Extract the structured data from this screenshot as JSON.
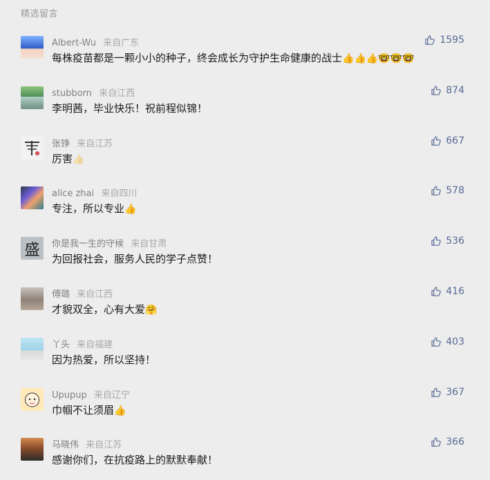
{
  "section_title": "精选留言",
  "comments": [
    {
      "nickname": "Albert-Wu",
      "location": "来自广东",
      "text": "每株疫苗都是一颗小小的种子，终会成长为守护生命健康的战士",
      "emoji": "👍👍👍🤓🤓🤓",
      "likes": "1595"
    },
    {
      "nickname": "stubborn",
      "location": "来自江西",
      "text": "李明茜，毕业快乐！祝前程似锦！",
      "emoji": "",
      "likes": "874"
    },
    {
      "nickname": "张铮",
      "location": "来自江苏",
      "text": "厉害",
      "emoji": "👍",
      "likes": "667"
    },
    {
      "nickname": "alice zhai",
      "location": "来自四川",
      "text": "专注，所以专业",
      "emoji": "👍",
      "likes": "578"
    },
    {
      "nickname": "你是我一生的守候",
      "location": "来自甘肃",
      "text": "为回报社会，服务人民的学子点赞！",
      "emoji": "",
      "likes": "536"
    },
    {
      "nickname": "傅璐",
      "location": "来自江西",
      "text": "才貌双全，心有大爱",
      "emoji": "🤗",
      "likes": "416"
    },
    {
      "nickname": "丫头",
      "location": "来自福建",
      "text": "因为热爱，所以坚持！",
      "emoji": "",
      "likes": "403"
    },
    {
      "nickname": "Upupup",
      "location": "来自辽宁",
      "text": "巾帼不让须眉",
      "emoji": "👍",
      "likes": "367"
    },
    {
      "nickname": "马晓伟",
      "location": "来自江苏",
      "text": "感谢你们，在抗疫路上的默默奉献！",
      "emoji": "",
      "likes": "366"
    }
  ],
  "avatar_text": {
    "5": "盛"
  },
  "colors": {
    "background": "#ededed",
    "like_color": "#576b95",
    "nickname_color": "#808080",
    "location_color": "#a8a8a8",
    "content_color": "#1a1a1a"
  },
  "icons": {
    "like": "thumbs-up-icon"
  }
}
